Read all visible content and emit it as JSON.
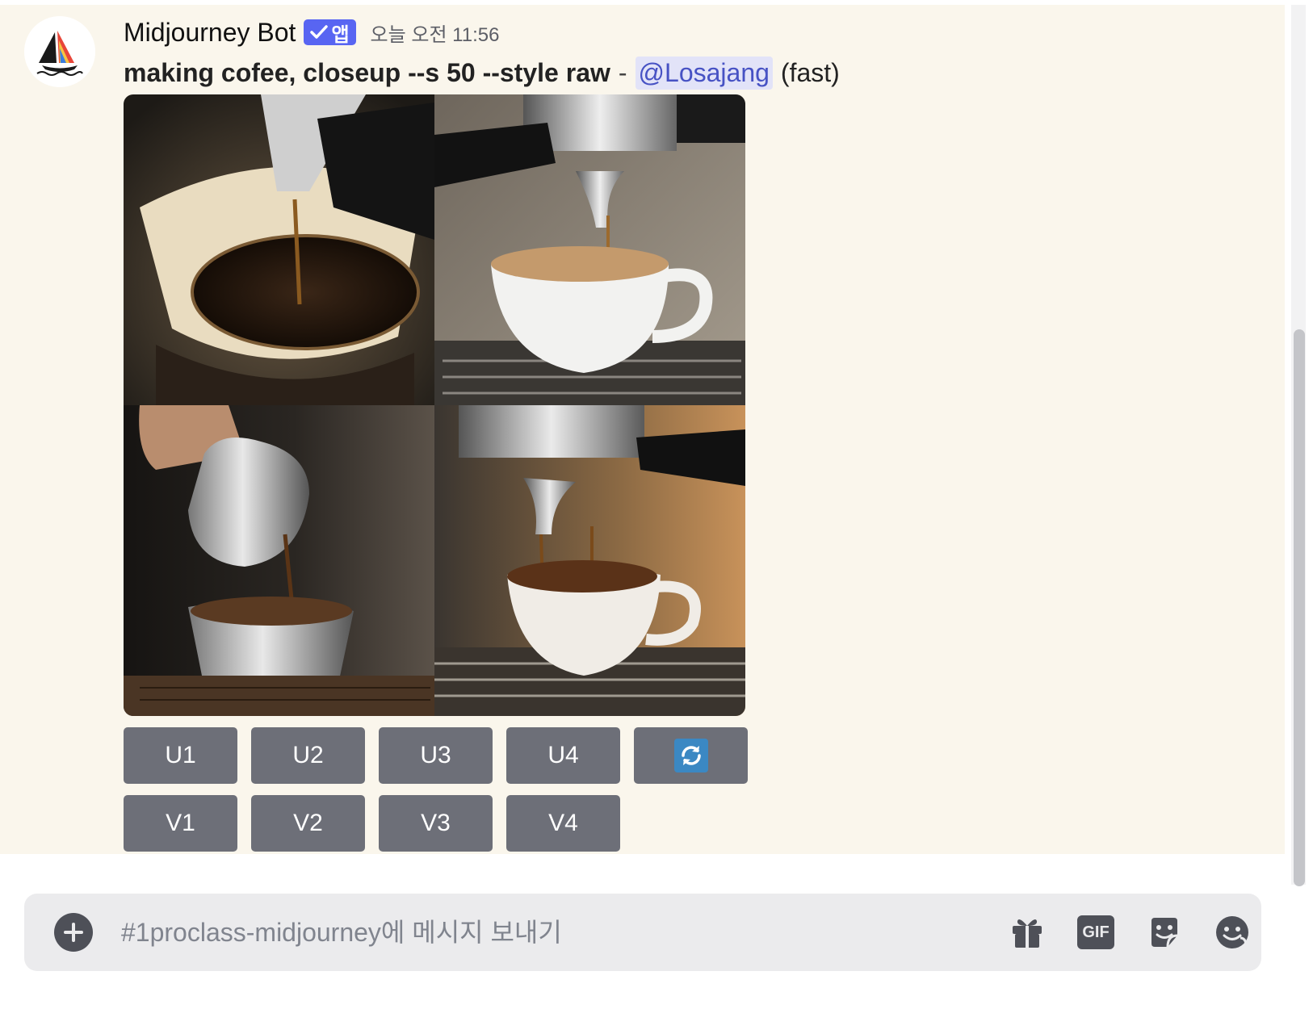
{
  "message": {
    "author": "Midjourney Bot",
    "badge_label": "앱",
    "timestamp": "오늘 오전 11:56",
    "prompt": "making cofee, closeup --s 50 --style raw",
    "separator": "-",
    "mention": "@Losajang",
    "speed": "(fast)",
    "images": [
      {
        "subject": "pour-over-coffee"
      },
      {
        "subject": "espresso-into-cup"
      },
      {
        "subject": "pitcher-pouring"
      },
      {
        "subject": "espresso-machine-cup"
      }
    ]
  },
  "actions": {
    "upscale": [
      "U1",
      "U2",
      "U3",
      "U4"
    ],
    "variation": [
      "V1",
      "V2",
      "V3",
      "V4"
    ],
    "reroll_icon": "refresh-icon"
  },
  "composer": {
    "placeholder": "#1proclass-midjourney에 메시지 보내기",
    "gif_label": "GIF",
    "icons": [
      "add-circle-icon",
      "gift-icon",
      "gif-icon",
      "sticker-icon",
      "emoji-icon"
    ]
  },
  "colors": {
    "highlight_bg": "#faf6ec",
    "badge": "#5865f2",
    "button": "#6d6f78",
    "mention_bg": "#e2e3f8",
    "mention_text": "#4752c4"
  }
}
